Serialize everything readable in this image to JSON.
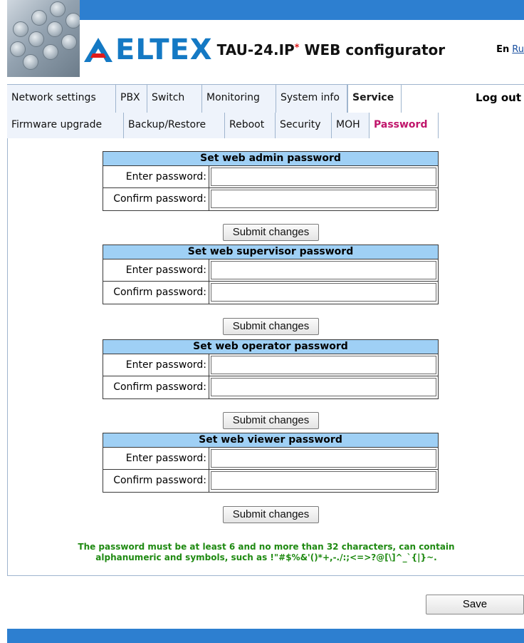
{
  "header": {
    "logo_text": "ELTEX",
    "product_name": "TAU-24.IP",
    "product_mark": "*",
    "product_suffix": "WEB configurator",
    "lang_en": "En",
    "lang_ru": "Ru"
  },
  "topnav": {
    "tabs": [
      {
        "label": "Network settings"
      },
      {
        "label": "PBX"
      },
      {
        "label": "Switch"
      },
      {
        "label": "Monitoring"
      },
      {
        "label": "System info"
      },
      {
        "label": "Service"
      }
    ],
    "active": "Service",
    "logout": "Log out"
  },
  "subnav": {
    "tabs": [
      {
        "label": "Firmware upgrade"
      },
      {
        "label": "Backup/Restore"
      },
      {
        "label": "Reboot"
      },
      {
        "label": "Security"
      },
      {
        "label": "MOH"
      },
      {
        "label": "Password"
      }
    ],
    "active": "Password"
  },
  "sections": [
    {
      "title": "Set web admin password",
      "enter_label": "Enter password:",
      "confirm_label": "Confirm password:",
      "enter_value": "",
      "confirm_value": "",
      "submit": "Submit changes"
    },
    {
      "title": "Set web supervisor password",
      "enter_label": "Enter password:",
      "confirm_label": "Confirm password:",
      "enter_value": "",
      "confirm_value": "",
      "submit": "Submit changes"
    },
    {
      "title": "Set web operator password",
      "enter_label": "Enter password:",
      "confirm_label": "Confirm password:",
      "enter_value": "",
      "confirm_value": "",
      "submit": "Submit changes"
    },
    {
      "title": "Set web viewer password",
      "enter_label": "Enter password:",
      "confirm_label": "Confirm password:",
      "enter_value": "",
      "confirm_value": "",
      "submit": "Submit changes"
    }
  ],
  "note": {
    "line1": "The password must be at least 6 and no more than 32 characters, can contain",
    "line2": "alphanumeric and symbols, such as !\"#$%&'()*+,-./:;<=>?@[\\]^_`{|}~."
  },
  "save_label": "Save",
  "colors": {
    "brand_blue": "#2d7fd0",
    "logo_blue": "#1479c4",
    "table_header": "#9fd0f5",
    "note_green": "#1f8a12",
    "active_subtab": "#c0156b"
  },
  "icons": [
    "eltex-logo-icon"
  ]
}
